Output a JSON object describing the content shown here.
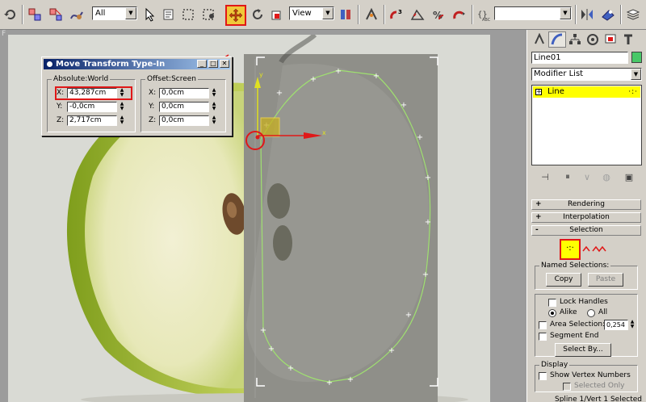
{
  "toolbar": {
    "selection_filter": "All",
    "reference_coord": "View",
    "named_selection": "",
    "icons": [
      "undo-icon",
      "link-icon",
      "unlink-icon",
      "bind-space-warp-icon",
      "select-object-icon",
      "select-by-name-icon",
      "rect-region-icon",
      "window-crossing-icon",
      "move-icon",
      "rotate-icon",
      "scale-icon",
      "pivot-icon",
      "manipulate-icon",
      "snap-3d-icon",
      "angle-snap-icon",
      "percent-snap-icon",
      "spinner-snap-icon",
      "edit-named-selections-icon",
      "mirror-icon",
      "align-icon",
      "layer-manager-icon"
    ]
  },
  "dialog": {
    "title": "Move Transform Type-In",
    "absolute_group": "Absolute:World",
    "offset_group": "Offset:Screen",
    "absolute": [
      {
        "axis": "X:",
        "value": "43,287cm"
      },
      {
        "axis": "Y:",
        "value": "-0,0cm"
      },
      {
        "axis": "Z:",
        "value": "2,717cm"
      }
    ],
    "offset": [
      {
        "axis": "X:",
        "value": "0,0cm"
      },
      {
        "axis": "Y:",
        "value": "0,0cm"
      },
      {
        "axis": "Z:",
        "value": "0,0cm"
      }
    ]
  },
  "viewport": {
    "label": "F",
    "gizmo_axes": {
      "x": "x",
      "y": "y"
    }
  },
  "panel": {
    "object_name": "Line01",
    "object_color": "#48c868",
    "modifier_list": "Modifier List",
    "stack_item": "Line",
    "rollouts": {
      "rendering": "Rendering",
      "interpolation": "Interpolation",
      "selection": "Selection"
    },
    "selection": {
      "named_selections_label": "Named Selections:",
      "copy": "Copy",
      "paste": "Paste",
      "lock_handles": "Lock Handles",
      "alike": "Alike",
      "all": "All",
      "area_selection": "Area Selection:",
      "area_value": "0,254",
      "segment_end": "Segment End",
      "select_by": "Select By...",
      "display_label": "Display",
      "show_vertex_numbers": "Show Vertex Numbers",
      "selected_only": "Selected Only",
      "status": "Spline 1/Vert 1 Selected"
    },
    "rollout_signs": {
      "plus": "+",
      "minus": "-"
    }
  },
  "colors": {
    "accent_red": "#e01818",
    "highlight_yellow": "#ffff00",
    "spline_green": "#9fe070"
  }
}
